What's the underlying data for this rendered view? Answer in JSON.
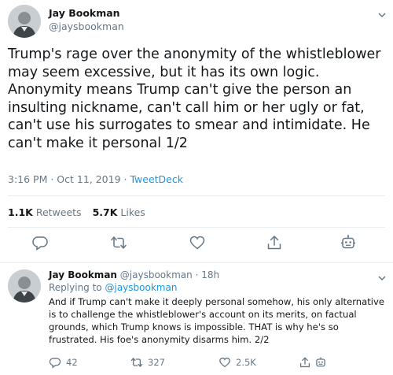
{
  "main_tweet": {
    "author_name": "Jay Bookman",
    "author_handle": "@jaysbookman",
    "text": "Trump's rage over the anonymity of the whistleblower may seem excessive, but it has its own logic. Anonymity means Trump can't give the person an insulting nickname, can't call him or her ugly or fat, can't use his surrogates to smear and intimidate. He can't make it personal 1/2",
    "timestamp": "3:16 PM · Oct 11, 2019",
    "separator": " · ",
    "source": "TweetDeck",
    "retweets_count": "1.1K",
    "retweets_label": "Retweets",
    "likes_count": "5.7K",
    "likes_label": "Likes",
    "actions": [
      "reply-icon",
      "retweet-icon",
      "like-icon",
      "share-icon",
      "bot-icon"
    ]
  },
  "reply_tweet": {
    "author_name": "Jay Bookman",
    "author_handle": "@jaysbookman",
    "time": "· 18h",
    "replying_to_label": "Replying to",
    "replying_to_handle": "@jaysbookman",
    "text": "And if Trump can't make it deeply personal somehow, his only alternative is to challenge the whistleblower's account on its merits, on factual grounds, which Trump knows is impossible. THAT is why he's so frustrated. His foe's anonymity disarms him. 2/2",
    "reply_count": "42",
    "retweet_count": "327",
    "like_count": "2.5K"
  },
  "colors": {
    "text": "#14171a",
    "secondary": "#657786",
    "link": "#1b95e0",
    "border": "#e6ecf0"
  }
}
